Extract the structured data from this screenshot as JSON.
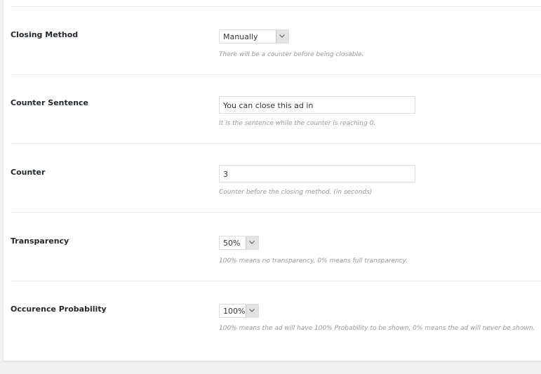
{
  "settings": [
    {
      "label": "Closing Method",
      "type": "select",
      "value": "Manually",
      "description": "There will be a counter before being closable."
    },
    {
      "label": "Counter Sentence",
      "type": "text",
      "value": "You can close this ad in",
      "description": "It is the sentence while the counter is reaching 0."
    },
    {
      "label": "Counter",
      "type": "text",
      "value": "3",
      "description": "Counter before the closing method. (in seconds)"
    },
    {
      "label": "Transparency",
      "type": "select",
      "value": "50%",
      "description": "100% means no transparency, 0% means full transparency."
    },
    {
      "label": "Occurence Probability",
      "type": "select",
      "value": "100%",
      "description": "100% means the ad will have 100% Probability to be shown, 0% means the ad will never be shown."
    }
  ],
  "icons": {
    "dropdown": "chevron-down-icon"
  }
}
